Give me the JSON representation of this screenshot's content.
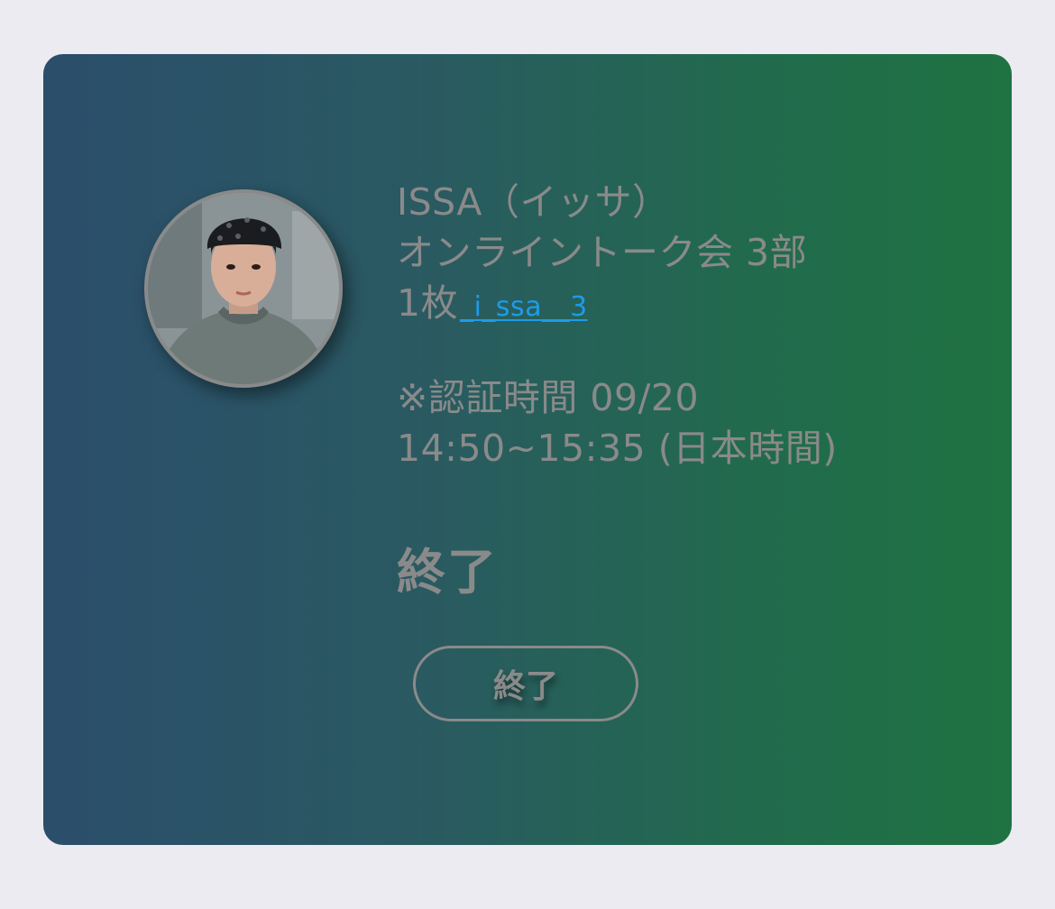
{
  "ticket": {
    "artist": "ISSA（イッサ）",
    "event": "オンライントーク会 3部",
    "count": "1枚",
    "handle": "_i_ssa__3",
    "auth_label": "※認証時間 09/20",
    "auth_time": "14:50~15:35 (日本時間)",
    "status": "終了",
    "button_label": "終了"
  },
  "colors": {
    "background": "#ecebf1",
    "card_gradient_start": "#2b4e6b",
    "card_gradient_end": "#1f7242",
    "text": "#8a8a8a",
    "link": "#1e9be9"
  }
}
